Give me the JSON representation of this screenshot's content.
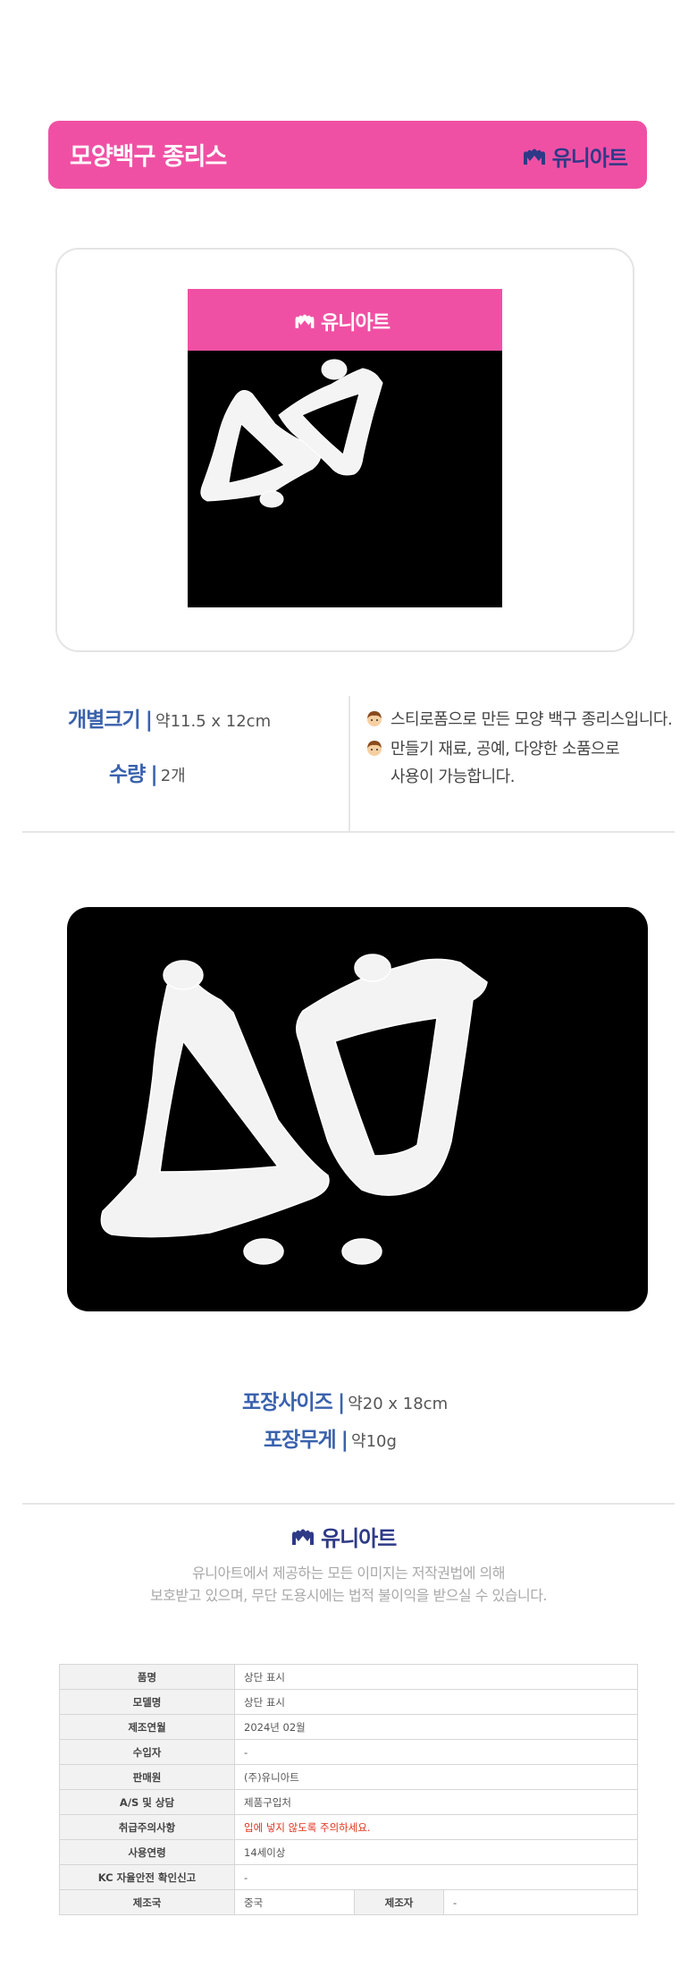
{
  "header": {
    "title": "모양백구 종리스",
    "brand": "유니아트"
  },
  "product_shot": {
    "brand": "유니아트"
  },
  "specs": {
    "size_label": "개별크기",
    "size_value": "약11.5 x 12cm",
    "qty_label": "수량",
    "qty_value": "2개",
    "sep": "|"
  },
  "description": {
    "line1": "스티로폼으로 만든 모양 백구 종리스입니다.",
    "line2": "만들기 재료, 공예, 다양한 소품으로",
    "line3": "사용이 가능합니다."
  },
  "packaging": {
    "size_label": "포장사이즈",
    "size_value": "약20 x 18cm",
    "weight_label": "포장무게",
    "weight_value": "약10g"
  },
  "footer": {
    "brand": "유니아트",
    "notice1": "유니아트에서 제공하는 모든 이미지는 저작권법에 의해",
    "notice2": "보호받고 있으며, 무단 도용시에는 법적 불이익을 받으실 수 있습니다."
  },
  "info_table": [
    {
      "key": "품명",
      "value": "상단 표시"
    },
    {
      "key": "모델명",
      "value": "상단 표시"
    },
    {
      "key": "제조연월",
      "value": "2024년 02월"
    },
    {
      "key": "수입자",
      "value": "-"
    },
    {
      "key": "판매원",
      "value": "(주)유니아트"
    },
    {
      "key": "A/S 및 상담",
      "value": "제품구입처"
    },
    {
      "key": "취급주의사항",
      "value": "입에 넣지 않도록 주의하세요."
    },
    {
      "key": "사용연령",
      "value": "14세이상"
    },
    {
      "key": "KC 자율안전 확인신고",
      "value": "-"
    }
  ],
  "info_last": {
    "key": "제조국",
    "value": "중국",
    "key2": "제조자",
    "value2": "-"
  },
  "colors": {
    "brand_pink": "#f050a4",
    "brand_navy": "#2e3a87",
    "label_blue": "#3a62ad",
    "warning_red": "#e0321b"
  }
}
